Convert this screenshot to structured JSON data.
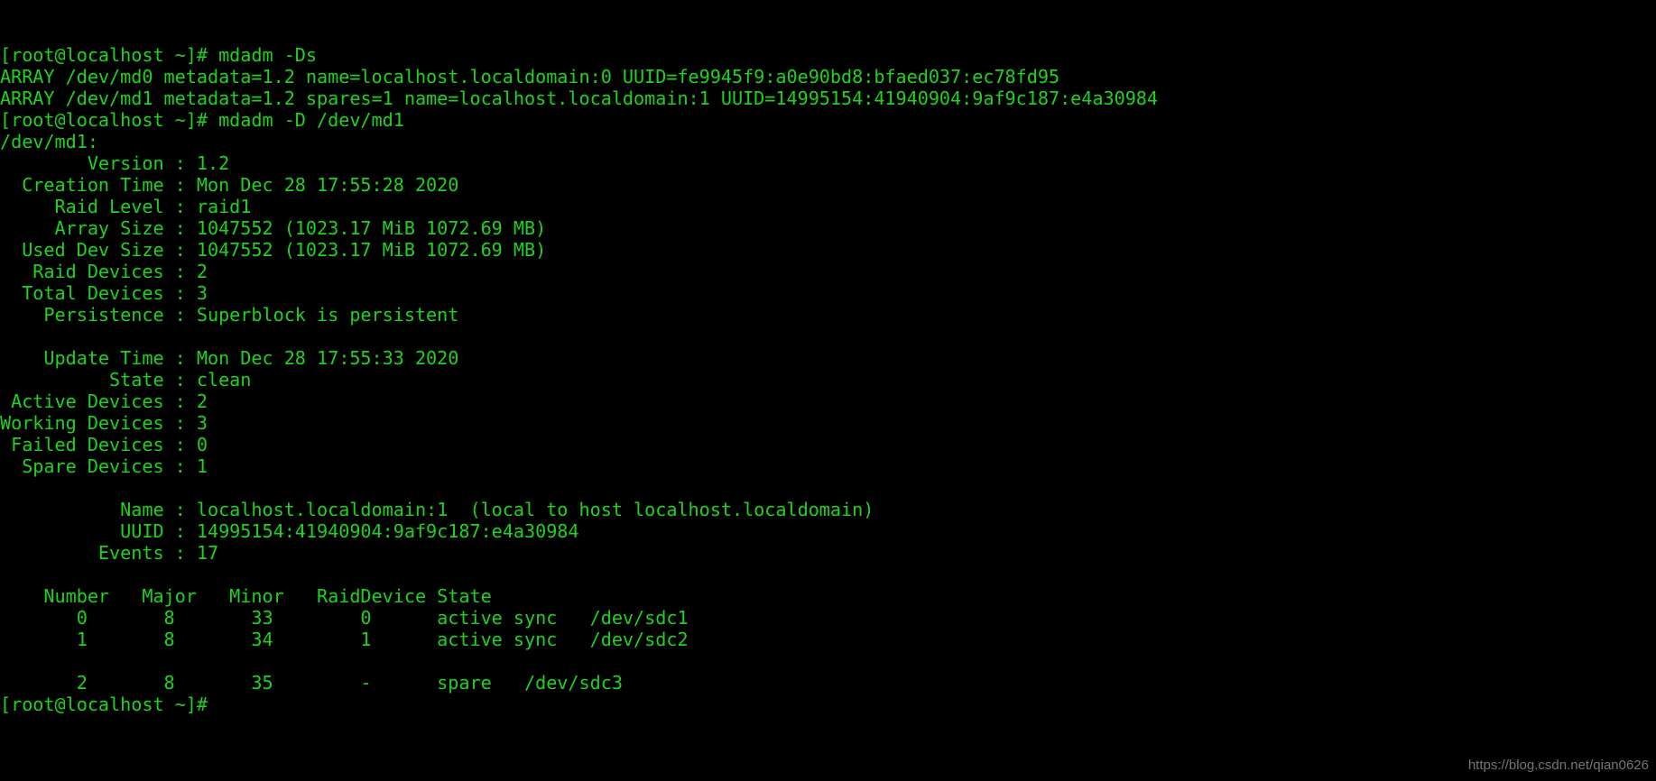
{
  "terminal": {
    "background_color": "#000000",
    "foreground_color": "#1ed21e",
    "prompt": "[root@localhost ~]#",
    "watermark": "https://blog.csdn.net/qian0626",
    "lines": [
      "[root@localhost ~]# mdadm -Ds",
      "ARRAY /dev/md0 metadata=1.2 name=localhost.localdomain:0 UUID=fe9945f9:a0e90bd8:bfaed037:ec78fd95",
      "ARRAY /dev/md1 metadata=1.2 spares=1 name=localhost.localdomain:1 UUID=14995154:41940904:9af9c187:e4a30984",
      "[root@localhost ~]# mdadm -D /dev/md1",
      "/dev/md1:",
      "        Version : 1.2",
      "  Creation Time : Mon Dec 28 17:55:28 2020",
      "     Raid Level : raid1",
      "     Array Size : 1047552 (1023.17 MiB 1072.69 MB)",
      "  Used Dev Size : 1047552 (1023.17 MiB 1072.69 MB)",
      "   Raid Devices : 2",
      "  Total Devices : 3",
      "    Persistence : Superblock is persistent",
      "",
      "    Update Time : Mon Dec 28 17:55:33 2020",
      "          State : clean",
      " Active Devices : 2",
      "Working Devices : 3",
      " Failed Devices : 0",
      "  Spare Devices : 1",
      "",
      "           Name : localhost.localdomain:1  (local to host localhost.localdomain)",
      "           UUID : 14995154:41940904:9af9c187:e4a30984",
      "         Events : 17",
      "",
      "    Number   Major   Minor   RaidDevice State",
      "       0       8       33        0      active sync   /dev/sdc1",
      "       1       8       34        1      active sync   /dev/sdc2",
      "",
      "       2       8       35        -      spare   /dev/sdc3",
      "[root@localhost ~]#"
    ],
    "commands": [
      "mdadm -Ds",
      "mdadm -D /dev/md1"
    ],
    "mdadm_scan": {
      "arrays": [
        {
          "device": "/dev/md0",
          "metadata": "1.2",
          "name": "localhost.localdomain:0",
          "uuid": "fe9945f9:a0e90bd8:bfaed037:ec78fd95"
        },
        {
          "device": "/dev/md1",
          "metadata": "1.2",
          "spares": "1",
          "name": "localhost.localdomain:1",
          "uuid": "14995154:41940904:9af9c187:e4a30984"
        }
      ]
    },
    "mdadm_detail": {
      "device": "/dev/md1:",
      "fields": [
        {
          "label": "Version",
          "value": "1.2"
        },
        {
          "label": "Creation Time",
          "value": "Mon Dec 28 17:55:28 2020"
        },
        {
          "label": "Raid Level",
          "value": "raid1"
        },
        {
          "label": "Array Size",
          "value": "1047552 (1023.17 MiB 1072.69 MB)"
        },
        {
          "label": "Used Dev Size",
          "value": "1047552 (1023.17 MiB 1072.69 MB)"
        },
        {
          "label": "Raid Devices",
          "value": "2"
        },
        {
          "label": "Total Devices",
          "value": "3"
        },
        {
          "label": "Persistence",
          "value": "Superblock is persistent"
        },
        {
          "label": "Update Time",
          "value": "Mon Dec 28 17:55:33 2020"
        },
        {
          "label": "State",
          "value": "clean"
        },
        {
          "label": "Active Devices",
          "value": "2"
        },
        {
          "label": "Working Devices",
          "value": "3"
        },
        {
          "label": "Failed Devices",
          "value": "0"
        },
        {
          "label": "Spare Devices",
          "value": "1"
        },
        {
          "label": "Name",
          "value": "localhost.localdomain:1  (local to host localhost.localdomain)"
        },
        {
          "label": "UUID",
          "value": "14995154:41940904:9af9c187:e4a30984"
        },
        {
          "label": "Events",
          "value": "17"
        }
      ],
      "table": {
        "headers": [
          "Number",
          "Major",
          "Minor",
          "RaidDevice",
          "State"
        ],
        "rows": [
          {
            "number": "0",
            "major": "8",
            "minor": "33",
            "raid_device": "0",
            "state": "active sync",
            "device": "/dev/sdc1"
          },
          {
            "number": "1",
            "major": "8",
            "minor": "34",
            "raid_device": "1",
            "state": "active sync",
            "device": "/dev/sdc2"
          },
          {
            "number": "2",
            "major": "8",
            "minor": "35",
            "raid_device": "-",
            "state": "spare",
            "device": "/dev/sdc3"
          }
        ]
      }
    }
  }
}
